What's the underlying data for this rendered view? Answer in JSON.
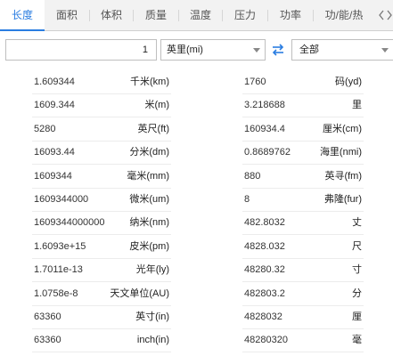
{
  "tabs": [
    {
      "label": "长度",
      "active": true
    },
    {
      "label": "面积",
      "active": false
    },
    {
      "label": "体积",
      "active": false
    },
    {
      "label": "质量",
      "active": false
    },
    {
      "label": "温度",
      "active": false
    },
    {
      "label": "压力",
      "active": false
    },
    {
      "label": "功率",
      "active": false
    },
    {
      "label": "功/能/热",
      "active": false
    }
  ],
  "tab_scroll_icon": "chevron-left-right",
  "input": {
    "value": "1"
  },
  "unit_select": {
    "selected": "英里(mi)"
  },
  "swap_icon": "swap-arrows",
  "category_select": {
    "selected": "全部"
  },
  "accent_color": "#2a7de1",
  "results_left": [
    {
      "value": "1.609344",
      "unit": "千米(km)"
    },
    {
      "value": "1609.344",
      "unit": "米(m)"
    },
    {
      "value": "5280",
      "unit": "英尺(ft)"
    },
    {
      "value": "16093.44",
      "unit": "分米(dm)"
    },
    {
      "value": "1609344",
      "unit": "毫米(mm)"
    },
    {
      "value": "1609344000",
      "unit": "微米(um)"
    },
    {
      "value": "1609344000000",
      "unit": "纳米(nm)"
    },
    {
      "value": "1.6093e+15",
      "unit": "皮米(pm)"
    },
    {
      "value": "1.7011e-13",
      "unit": "光年(ly)"
    },
    {
      "value": "1.0758e-8",
      "unit": "天文单位(AU)"
    },
    {
      "value": "63360",
      "unit": "英寸(in)"
    },
    {
      "value": "63360",
      "unit": "inch(in)"
    }
  ],
  "results_right": [
    {
      "value": "1760",
      "unit": "码(yd)"
    },
    {
      "value": "3.218688",
      "unit": "里"
    },
    {
      "value": "160934.4",
      "unit": "厘米(cm)"
    },
    {
      "value": "0.8689762",
      "unit": "海里(nmi)"
    },
    {
      "value": "880",
      "unit": "英寻(fm)"
    },
    {
      "value": "8",
      "unit": "弗隆(fur)"
    },
    {
      "value": "482.8032",
      "unit": "丈"
    },
    {
      "value": "4828.032",
      "unit": "尺"
    },
    {
      "value": "48280.32",
      "unit": "寸"
    },
    {
      "value": "482803.2",
      "unit": "分"
    },
    {
      "value": "4828032",
      "unit": "厘"
    },
    {
      "value": "48280320",
      "unit": "毫"
    }
  ]
}
